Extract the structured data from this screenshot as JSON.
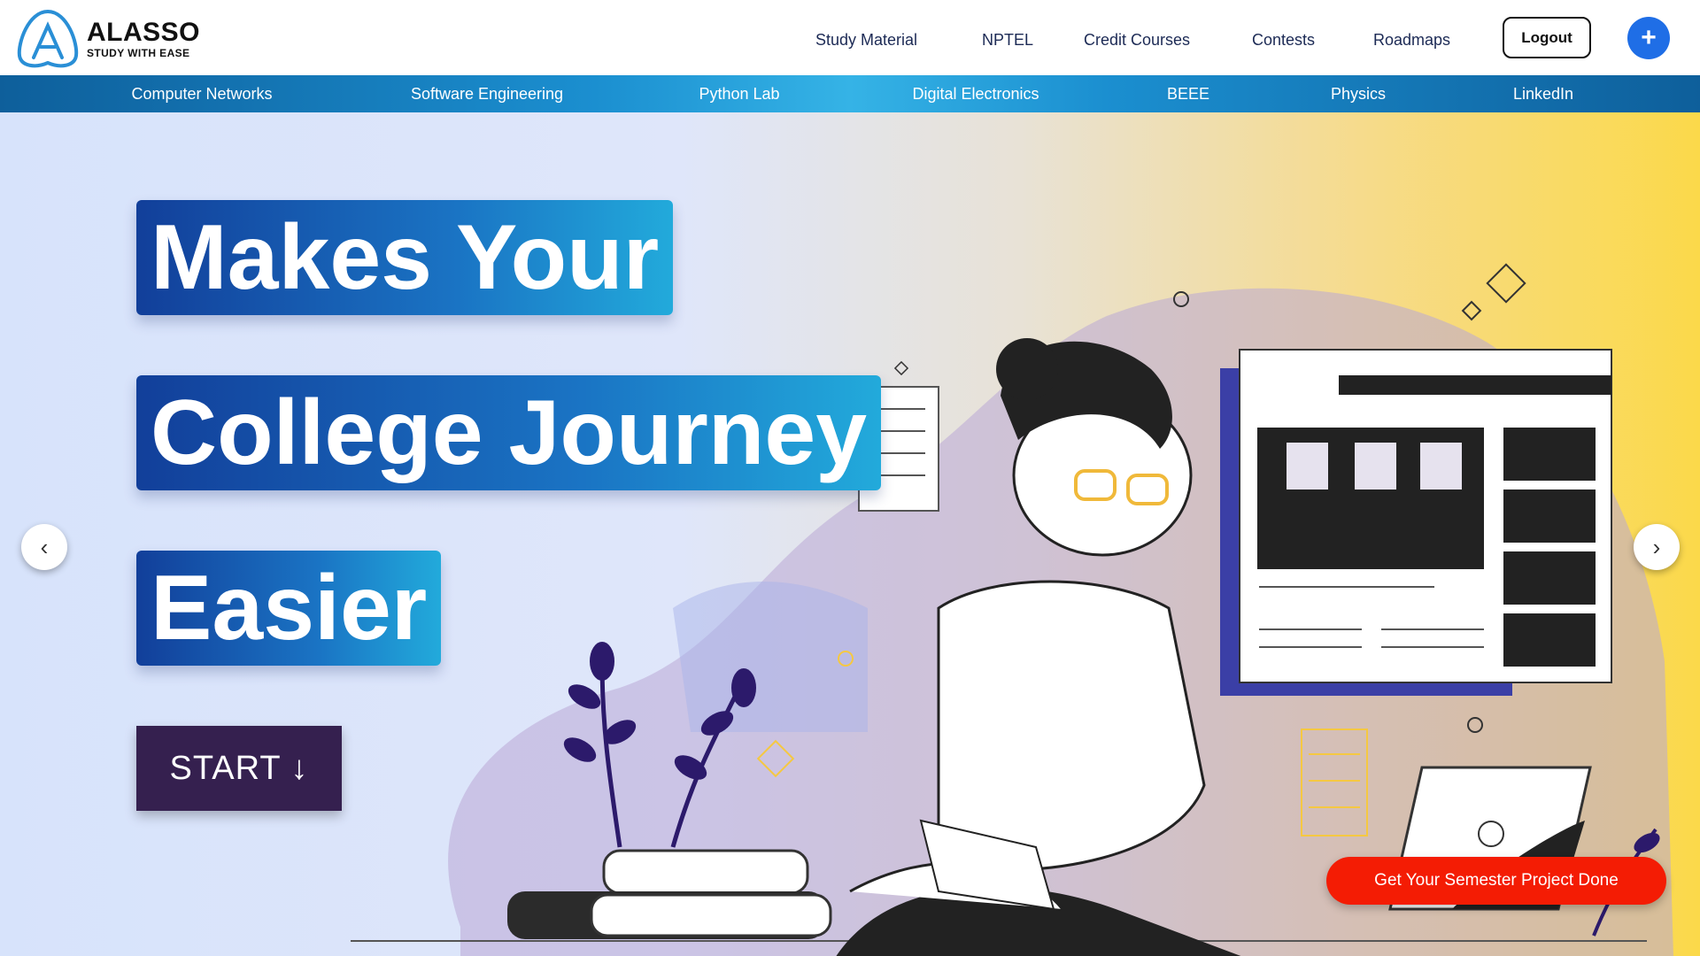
{
  "brand": {
    "title": "ALASSO",
    "tagline": "STUDY WITH EASE"
  },
  "header": {
    "nav": [
      "Study Material",
      "NPTEL",
      "Credit Courses",
      "Contests",
      "Roadmaps"
    ],
    "logout_label": "Logout",
    "plus_label": "+"
  },
  "subnav": [
    "Computer Networks",
    "Software Engineering",
    "Python Lab",
    "Digital Electronics",
    "BEEE",
    "Physics",
    "LinkedIn"
  ],
  "hero": {
    "lines": [
      "Makes Your",
      "College Journey",
      "Easier"
    ],
    "start_label": "START ↓",
    "prev_label": "‹",
    "next_label": "›"
  },
  "cta": {
    "label": "Get Your Semester Project Done"
  },
  "colors": {
    "accent": "#1f6ee6",
    "cta": "#f41c04",
    "start": "#35204f",
    "subnav": "#1b8fd0"
  },
  "icons": {
    "logo": "alasso-logo-icon",
    "plus": "plus-icon",
    "prev": "chevron-left-icon",
    "next": "chevron-right-icon"
  }
}
